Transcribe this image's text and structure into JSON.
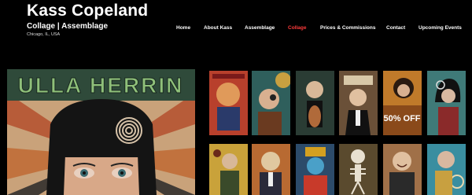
{
  "header": {
    "title": "Kass Copeland",
    "subtitle": "Collage | Assemblage",
    "location": "Chicago, IL, USA"
  },
  "nav": {
    "items": [
      {
        "label": "Home",
        "active": false
      },
      {
        "label": "About Kass",
        "active": false
      },
      {
        "label": "Assemblage",
        "active": false
      },
      {
        "label": "Collage",
        "active": true
      },
      {
        "label": "Prices & Commissions",
        "active": false
      },
      {
        "label": "Contact",
        "active": false
      },
      {
        "label": "Upcoming Events",
        "active": false
      }
    ],
    "active_color": "#ff3b3b"
  },
  "featured": {
    "banner_text": "ULLA HERRIN",
    "colors": {
      "background": "#c9a27a",
      "banner": "#2f4a3a",
      "lettering": "#8fc07a",
      "hair": "#141414"
    }
  },
  "gallery": {
    "thumbs": [
      {
        "subject": "orange portrait collage",
        "color": "#b8402c"
      },
      {
        "subject": "steampunk woman collage",
        "color": "#2f5f5c"
      },
      {
        "subject": "figure with violin collage",
        "color": "#2a3c34"
      },
      {
        "subject": "man in tuxedo collage",
        "color": "#6a5038"
      },
      {
        "subject": "50% off sale collage",
        "color": "#c07a2a"
      },
      {
        "subject": "bob haircut woman collage",
        "color": "#3f7a78"
      },
      {
        "subject": "yellow mechanical figure collage",
        "color": "#c9a23a"
      },
      {
        "subject": "man with numbered head collage",
        "color": "#b86a32"
      },
      {
        "subject": "blue figure with crown collage",
        "color": "#2c4b6a"
      },
      {
        "subject": "skeleton collage",
        "color": "#5a4a2e"
      },
      {
        "subject": "smiling man in suit collage",
        "color": "#a07048"
      },
      {
        "subject": "teal woman collage",
        "color": "#3a8ea0"
      }
    ],
    "sale_text": "50% OFF"
  }
}
